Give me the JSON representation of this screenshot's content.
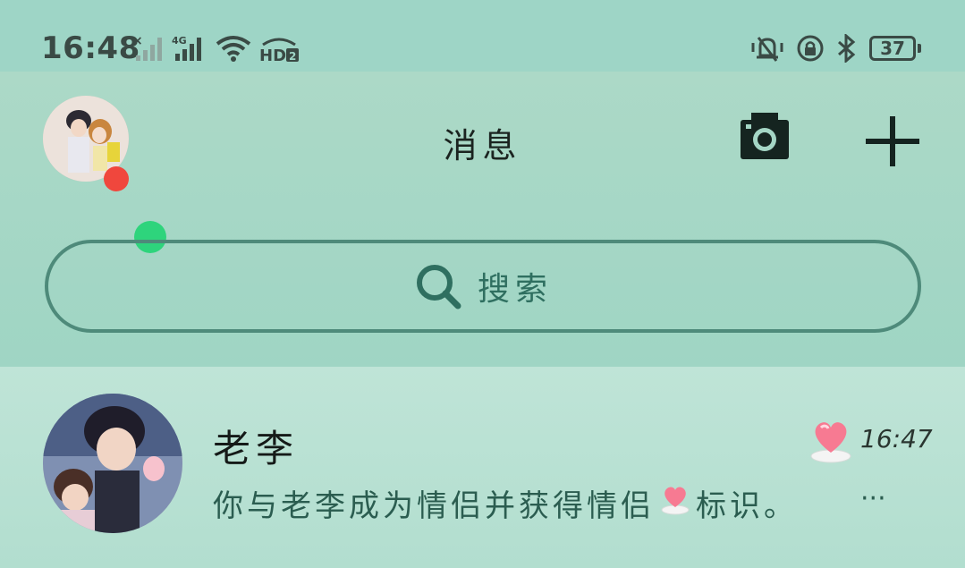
{
  "status_bar": {
    "time": "16:48",
    "network": "4G",
    "hd": "HD2",
    "battery": "37",
    "icons": [
      "signal-off-icon",
      "signal-4g-icon",
      "wifi-icon",
      "hd-icon",
      "silent-icon",
      "rotation-lock-icon",
      "bluetooth-icon",
      "battery-icon"
    ]
  },
  "header": {
    "title": "消息",
    "camera_icon": "camera-icon",
    "add_icon": "plus-icon"
  },
  "search": {
    "label": "搜索",
    "icon": "search-icon"
  },
  "conversations": [
    {
      "name": "老李",
      "time": "16:47",
      "preview_before": "你与老李成为情侣并获得情侣",
      "preview_after": "标识。",
      "more": "···",
      "badge_icon": "heart-icon"
    }
  ],
  "colors": {
    "accent": "#2f6f60",
    "unread_dot": "#f0473d",
    "online_dot": "#2ed47c"
  }
}
